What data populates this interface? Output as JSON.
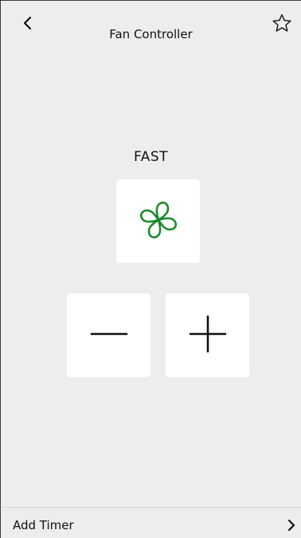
{
  "header": {
    "title": "Fan Controller",
    "back_icon": "chevron-left-icon",
    "favorite_icon": "star-outline-icon"
  },
  "fan": {
    "speed_label": "FAST",
    "icon": "fan-icon",
    "icon_color": "#1a8a2a"
  },
  "controls": {
    "decrease_icon": "minus-icon",
    "increase_icon": "plus-icon"
  },
  "footer": {
    "label": "Add Timer",
    "chevron_icon": "chevron-right-icon"
  }
}
